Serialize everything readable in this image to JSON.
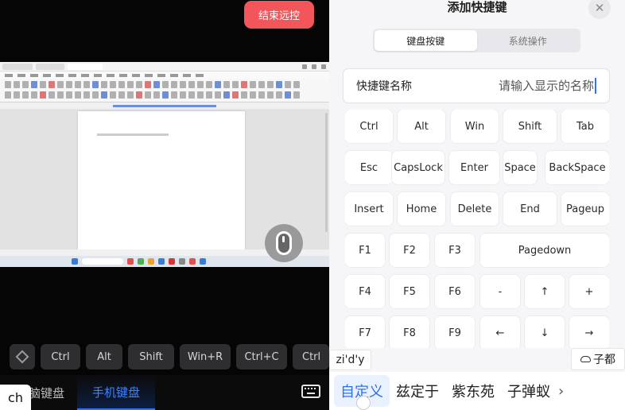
{
  "remote": {
    "end_button": "结束远控"
  },
  "quick_keys": [
    "Ctrl",
    "Alt",
    "Shift",
    "Win+R",
    "Ctrl+C",
    "Ctrl"
  ],
  "keyboard_modes": {
    "pc_label": "脑键盘",
    "phone_label": "手机键盘"
  },
  "ime_indicator": "ch",
  "sheet": {
    "title": "添加快捷键",
    "close_glyph": "✕",
    "tabs": [
      "键盘按键",
      "系统操作"
    ],
    "active_tab": 0,
    "name_label": "快捷键名称",
    "name_placeholder": "请输入显示的名称",
    "name_value": ""
  },
  "keys": [
    [
      "Ctrl",
      "Alt",
      "Win",
      "Shift",
      "Tab"
    ],
    [
      "Esc",
      "CapsLock",
      "Enter",
      "Space",
      "BackSpace"
    ],
    [
      "Insert",
      "Home",
      "Delete",
      "End",
      "Pageup"
    ],
    [
      "F1",
      "F2",
      "F3",
      "Pagedown"
    ],
    [
      "F4",
      "F5",
      "F6",
      "-",
      "↑",
      "+"
    ],
    [
      "F7",
      "F8",
      "F9",
      "←",
      "↓",
      "→"
    ]
  ],
  "ime": {
    "pinyin": "zi'd'y",
    "cloud_label": "子都",
    "candidates": [
      "自定义",
      "兹定于",
      "紫东苑",
      "子弹蚁"
    ],
    "more_glyph": "›"
  },
  "colors": {
    "accent": "#2f72ff",
    "end_button": "#f2555a"
  }
}
